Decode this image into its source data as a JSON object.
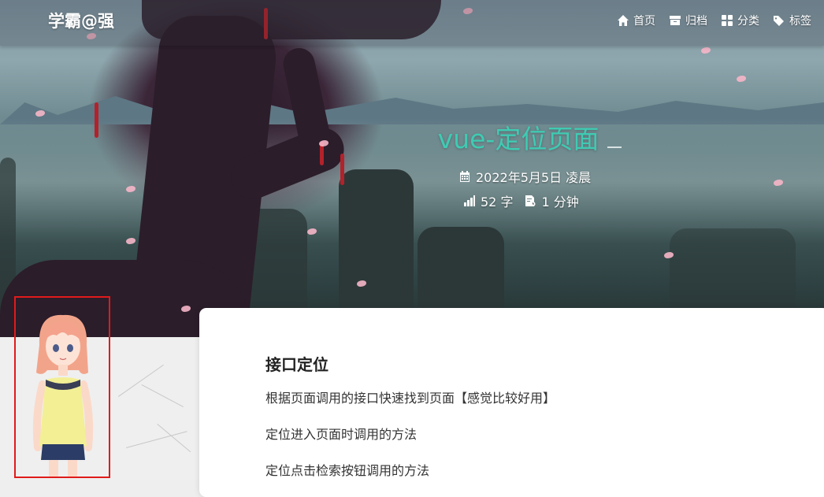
{
  "header": {
    "brand": "学霸@强",
    "nav": [
      {
        "icon": "home-icon",
        "label": "首页"
      },
      {
        "icon": "archive-icon",
        "label": "归档"
      },
      {
        "icon": "category-icon",
        "label": "分类"
      },
      {
        "icon": "tag-icon",
        "label": "标签"
      }
    ]
  },
  "post": {
    "title": "vue-定位页面",
    "date": "2022年5月5日 凌晨",
    "word_count": "52 字",
    "read_time": "1 分钟"
  },
  "content": {
    "heading": "接口定位",
    "paragraphs": [
      "根据页面调用的接口快速找到页面【感觉比较好用】",
      "定位进入页面时调用的方法",
      "定位点击检索按钮调用的方法"
    ]
  },
  "colors": {
    "title_accent": "#3fcbb3",
    "mascot_border": "#e01b1b"
  }
}
